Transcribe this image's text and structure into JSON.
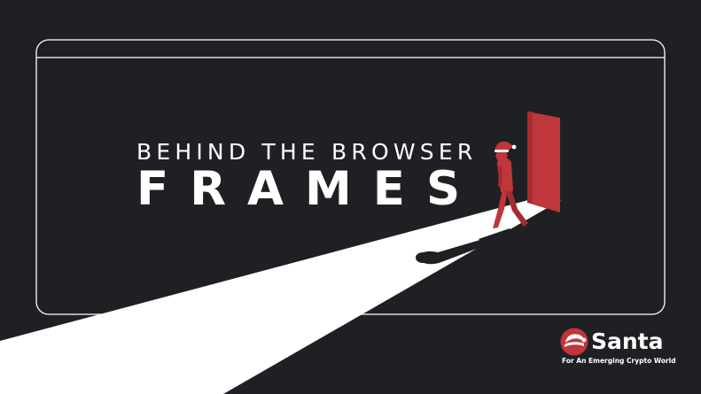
{
  "banner": {
    "kicker": "BEHIND THE BROWSER",
    "headline": "FRAMES"
  },
  "brand": {
    "name": "Santa",
    "tagline": "For An Emerging Crypto World"
  },
  "colors": {
    "background": "#1f2024",
    "accent_red": "#c0363a",
    "light_beam": "#ffffff",
    "frame_outline": "#ffffff"
  },
  "icons": {
    "brand_logo": "santa-hat-coin-icon",
    "figure": "santa-figure-illustration",
    "door": "open-red-door-illustration"
  }
}
